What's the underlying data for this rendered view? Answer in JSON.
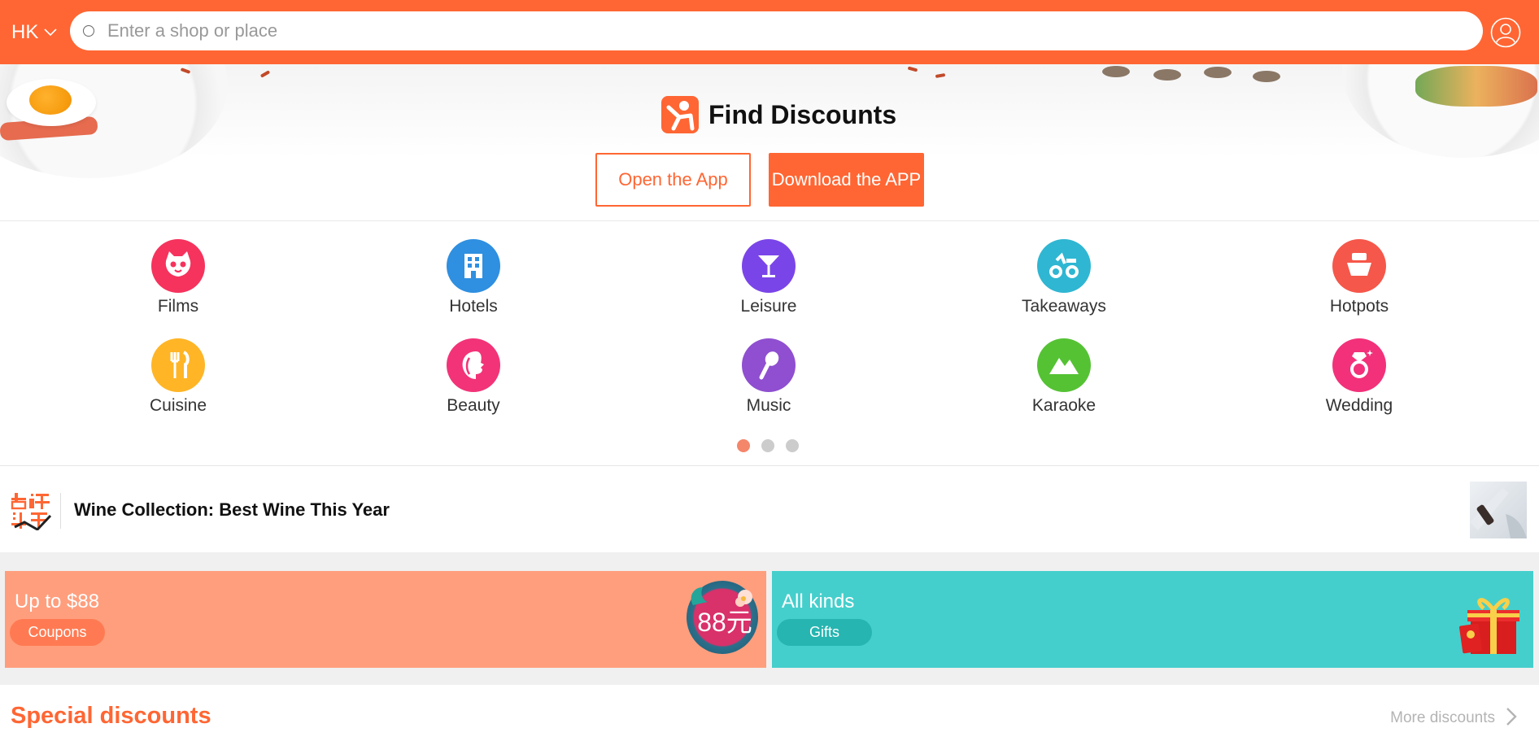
{
  "header": {
    "city": "HK",
    "search_placeholder": "Enter a shop or place"
  },
  "hero": {
    "title": "Find Discounts",
    "open_app": "Open the App",
    "download_app": "Download the APP"
  },
  "categories": [
    {
      "label": "Films",
      "icon": "cat-face-icon",
      "color": "#f5335d"
    },
    {
      "label": "Hotels",
      "icon": "building-icon",
      "color": "#2f8fe0"
    },
    {
      "label": "Leisure",
      "icon": "cocktail-icon",
      "color": "#7a45e8"
    },
    {
      "label": "Takeaways",
      "icon": "scooter-icon",
      "color": "#2fb6d2"
    },
    {
      "label": "Hotpots",
      "icon": "hotpot-icon",
      "color": "#f5574a"
    },
    {
      "label": "Cuisine",
      "icon": "fork-knife-icon",
      "color": "#ffb526"
    },
    {
      "label": "Beauty",
      "icon": "face-profile-icon",
      "color": "#f23378"
    },
    {
      "label": "Music",
      "icon": "microphone-icon",
      "color": "#8f4fd0"
    },
    {
      "label": "Karaoke",
      "icon": "mountain-icon",
      "color": "#55c234"
    },
    {
      "label": "Wedding",
      "icon": "ring-icon",
      "color": "#f2317a"
    }
  ],
  "pager": {
    "active": 1,
    "count": 3
  },
  "news": {
    "logo_text": "点评头条",
    "title": "Wine Collection: Best Wine This Year"
  },
  "promos": [
    {
      "title": "Up to $88",
      "pill": "Coupons",
      "badge": "88元",
      "color": "#ff9e7d"
    },
    {
      "title": "All kinds",
      "pill": "Gifts",
      "color": "#45cfcc"
    }
  ],
  "special": {
    "title": "Special discounts",
    "more": "More discounts"
  },
  "colors": {
    "brand": "#ff6633"
  }
}
